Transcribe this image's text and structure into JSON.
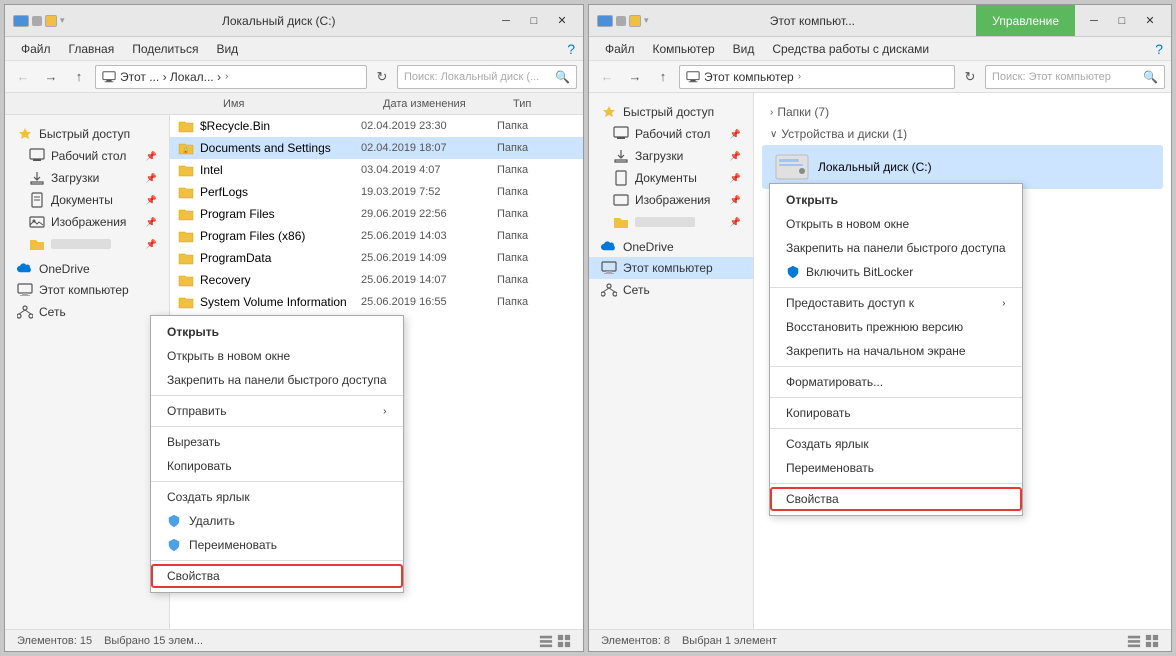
{
  "window1": {
    "title": "Локальный диск (C:)",
    "tabs": {
      "file": "Файл",
      "home": "Главная",
      "share": "Поделиться",
      "view": "Вид"
    },
    "toolbar": {
      "back": "←",
      "forward": "→",
      "up": "↑",
      "address": "Этот ... › Локал... ›",
      "search_placeholder": "Поиск: Локальный диск (..."
    },
    "columns": {
      "name": "Имя",
      "date": "Дата изменения",
      "type": "Тип"
    },
    "files": [
      {
        "name": "$Recycle.Bin",
        "date": "02.04.2019 23:30",
        "type": "Папка",
        "icon": "folder"
      },
      {
        "name": "Documents and Settings",
        "date": "02.04.2019 18:07",
        "type": "Папка",
        "icon": "folder-lock"
      },
      {
        "name": "Intel",
        "date": "03.04.2019 4:07",
        "type": "Папка",
        "icon": "folder"
      },
      {
        "name": "PerfLogs",
        "date": "19.03.2019 7:52",
        "type": "Папка",
        "icon": "folder"
      },
      {
        "name": "Program Files",
        "date": "29.06.2019 22:56",
        "type": "Папка",
        "icon": "folder"
      },
      {
        "name": "Program Files (x86)",
        "date": "25.06.2019 14:03",
        "type": "Папка",
        "icon": "folder"
      },
      {
        "name": "ProgramData",
        "date": "25.06.2019 14:09",
        "type": "Папка",
        "icon": "folder"
      },
      {
        "name": "Recovery",
        "date": "25.06.2019 14:07",
        "type": "Папка",
        "icon": "folder"
      },
      {
        "name": "System Volume Information",
        "date": "25.06.2019 16:55",
        "type": "Папка",
        "icon": "folder-lock"
      }
    ],
    "sidebar": {
      "quick_access": "Быстрый доступ",
      "desktop": "Рабочий стол",
      "downloads": "Загрузки",
      "documents": "Документы",
      "pictures": "Изображения",
      "user_folder": "",
      "onedrive": "OneDrive",
      "this_pc": "Этот компьютер",
      "network": "Сеть"
    },
    "context_menu": {
      "open": "Открыть",
      "open_new_window": "Открыть в новом окне",
      "pin_quick_access": "Закрепить на панели быстрого доступа",
      "send_to": "Отправить",
      "cut": "Вырезать",
      "copy": "Копировать",
      "create_shortcut": "Создать ярлык",
      "delete": "Удалить",
      "rename": "Переименовать",
      "properties": "Свойства"
    },
    "status_left": "Элементов: 15",
    "status_right": "Выбрано 15 элем..."
  },
  "window2": {
    "title": "Этот компьют...",
    "management_tab": "Управление",
    "tabs": {
      "file": "Файл",
      "computer": "Компьютер",
      "view": "Вид",
      "disk_tools": "Средства работы с дисками"
    },
    "toolbar": {
      "address": "Этот компьютер",
      "search_placeholder": "Поиск: Этот компьютер"
    },
    "sections": {
      "folders": "Папки (7)",
      "devices": "Устройства и диски (1)"
    },
    "drives": [
      {
        "name": "Локальный диск (С:)",
        "icon": "drive"
      }
    ],
    "sidebar": {
      "quick_access": "Быстрый доступ",
      "desktop": "Рабочий стол",
      "downloads": "Загрузки",
      "documents": "Документы",
      "pictures": "Изображения",
      "user_folder": "",
      "onedrive": "OneDrive",
      "this_pc": "Этот компьютер",
      "network": "Сеть"
    },
    "context_menu": {
      "open": "Открыть",
      "open_new_window": "Открыть в новом окне",
      "pin_quick_access": "Закрепить на панели быстрого доступа",
      "bitlocker": "Включить BitLocker",
      "share": "Предоставить доступ к",
      "restore": "Восстановить прежнюю версию",
      "pin_start": "Закрепить на начальном экране",
      "format": "Форматировать...",
      "copy": "Копировать",
      "create_shortcut": "Создать ярлык",
      "rename": "Переименовать",
      "properties": "Свойства"
    },
    "status_left": "Элементов: 8",
    "status_right": "Выбран 1 элемент"
  }
}
